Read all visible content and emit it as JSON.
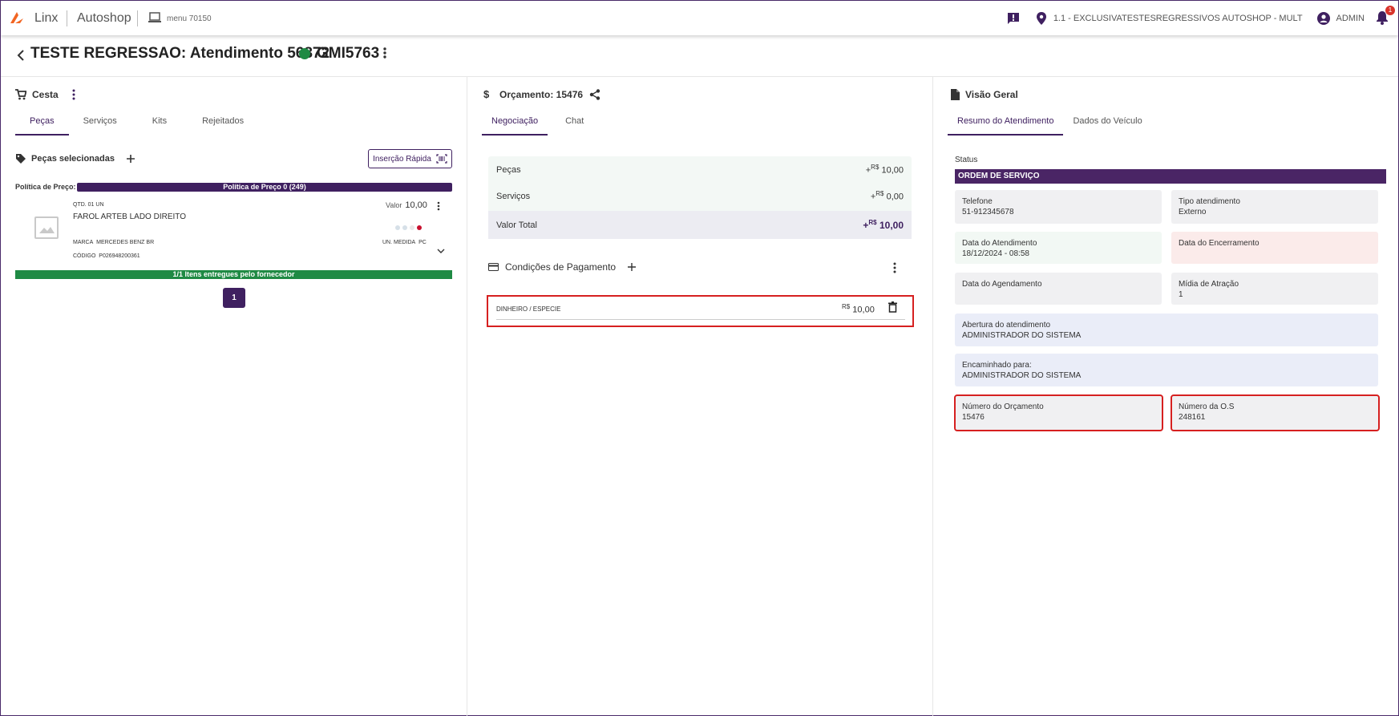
{
  "topbar": {
    "brand": "Linx",
    "app_name": "Autoshop",
    "menu_label": "menu 70150",
    "location": "1.1 - EXCLUSIVATESTESREGRESSIVOS AUTOSHOP - MULT",
    "user": "ADMIN",
    "notifications": "1"
  },
  "header": {
    "title": "TESTE REGRESSAO: Atendimento 56872",
    "plate": "GMI5763"
  },
  "cesta": {
    "title": "Cesta",
    "tabs": [
      "Peças",
      "Serviços",
      "Kits",
      "Rejeitados"
    ],
    "pecas_selecionadas": "Peças selecionadas",
    "insercao_rapida": "Inserção Rápida",
    "politica_label": "Política de Preço:",
    "politica_value": "Política de Preço 0 (249)",
    "item": {
      "qtd": "QTD. 01 UN",
      "name": "FAROL ARTEB LADO DIREITO",
      "valor_label": "Valor",
      "valor": "10,00",
      "marca_label": "MARCA",
      "marca": "MERCEDES BENZ BR",
      "un_medida_label": "UN. MEDIDA",
      "un_medida": "PC",
      "codigo_label": "CÓDIGO",
      "codigo": "P026948200361"
    },
    "entregues": "1/1 Itens entregues pelo fornecedor",
    "page": "1"
  },
  "orcamento": {
    "title": "Orçamento: 15476",
    "tabs": [
      "Negociação",
      "Chat"
    ],
    "rows": [
      {
        "label": "Peças",
        "currency": "R$",
        "value": "10,00"
      },
      {
        "label": "Serviços",
        "currency": "R$",
        "value": "0,00"
      },
      {
        "label": "Valor Total",
        "currency": "R$",
        "value": "10,00"
      }
    ],
    "condicoes_title": "Condições de Pagamento",
    "payment": {
      "name": "DINHEIRO / ESPECIE",
      "currency": "R$",
      "value": "10,00"
    }
  },
  "visao": {
    "title": "Visão Geral",
    "tabs": [
      "Resumo do Atendimento",
      "Dados do Veículo"
    ],
    "status_label": "Status",
    "status_value": "ORDEM DE SERVIÇO",
    "cards": {
      "telefone": {
        "label": "Telefone",
        "value": "51-912345678"
      },
      "tipo": {
        "label": "Tipo atendimento",
        "value": "Externo"
      },
      "data_atend": {
        "label": "Data do Atendimento",
        "value": "18/12/2024 - 08:58"
      },
      "data_enc": {
        "label": "Data do Encerramento",
        "value": ""
      },
      "data_agend": {
        "label": "Data do Agendamento",
        "value": ""
      },
      "midia": {
        "label": "Mídia de Atração",
        "value": "1"
      },
      "abertura": {
        "label": "Abertura do atendimento",
        "value": "ADMINISTRADOR DO SISTEMA"
      },
      "encaminhado": {
        "label": "Encaminhado para:",
        "value": "ADMINISTRADOR DO SISTEMA"
      },
      "num_orc": {
        "label": "Número do Orçamento",
        "value": "15476"
      },
      "num_os": {
        "label": "Número da O.S",
        "value": "248161"
      }
    }
  },
  "colors": {
    "primary": "#3f2060",
    "status_bar": "#4a2565",
    "success": "#1f8a44",
    "highlight": "#d62020",
    "logo": "#f26522"
  }
}
